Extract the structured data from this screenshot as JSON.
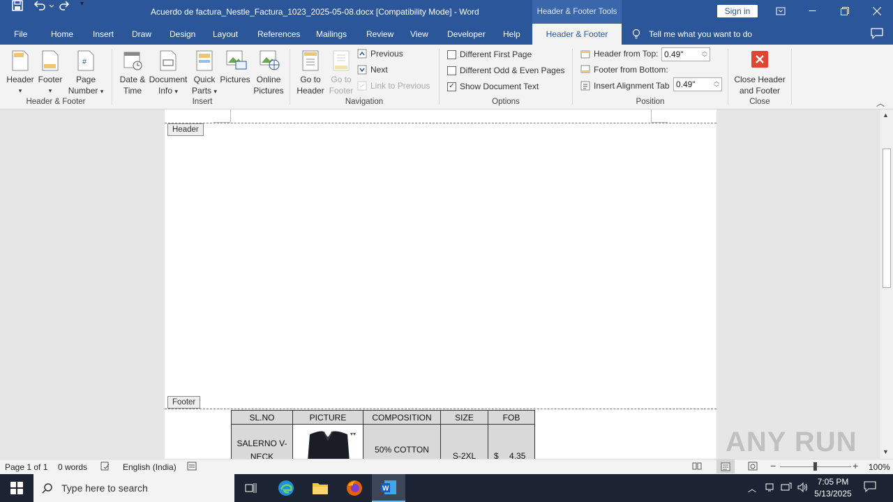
{
  "app": {
    "doc_title": "Acuerdo de factura_Nestle_Factura_1023_2025-05-08.docx [Compatibility Mode]  -  Word",
    "tools_title": "Header & Footer Tools",
    "signin": "Sign in",
    "accent": "#2b579a"
  },
  "tabs": [
    "File",
    "Home",
    "Insert",
    "Draw",
    "Design",
    "Layout",
    "References",
    "Mailings",
    "Review",
    "View",
    "Developer",
    "Help",
    "Header & Footer"
  ],
  "tellme": "Tell me what you want to do",
  "ribbon": {
    "hf": {
      "header": "Header",
      "footer": "Footer",
      "page_number_1": "Page",
      "page_number_2": "Number",
      "group": "Header & Footer"
    },
    "insert": {
      "date_1": "Date &",
      "date_2": "Time",
      "docinfo_1": "Document",
      "docinfo_2": "Info",
      "quick_1": "Quick",
      "quick_2": "Parts",
      "pictures": "Pictures",
      "online_1": "Online",
      "online_2": "Pictures",
      "group": "Insert"
    },
    "nav": {
      "goto_header_1": "Go to",
      "goto_header_2": "Header",
      "goto_footer_1": "Go to",
      "goto_footer_2": "Footer",
      "previous": "Previous",
      "next": "Next",
      "link_prev": "Link to Previous",
      "group": "Navigation"
    },
    "options": {
      "diff_first": "Different First Page",
      "diff_odd": "Different Odd & Even Pages",
      "show_doc": "Show Document Text",
      "group": "Options"
    },
    "position": {
      "header_top": "Header from Top:",
      "header_top_val": "0.49\"",
      "footer_bottom": "Footer from Bottom:",
      "footer_bottom_val": "0.49\"",
      "align_tab": "Insert Alignment Tab",
      "group": "Position"
    },
    "close": {
      "label_1": "Close Header",
      "label_2": "and Footer",
      "group": "Close"
    }
  },
  "page": {
    "header_label": "Header",
    "footer_label": "Footer",
    "table": {
      "headers": [
        "SL.NO",
        "PICTURE",
        "COMPOSITION",
        "SIZE",
        "FOB"
      ],
      "row": {
        "sl_1": "SALERNO V-",
        "sl_2": "NECK",
        "composition": "50% COTTON",
        "size": "S-2XL",
        "fob_currency": "$",
        "fob_value": "4.35"
      }
    }
  },
  "status": {
    "page": "Page 1 of 1",
    "words": "0 words",
    "language": "English (India)",
    "zoom": "100%"
  },
  "taskbar": {
    "search": "Type here to search",
    "time": "7:05 PM",
    "date": "5/13/2025"
  },
  "watermark": "ANY RUN"
}
